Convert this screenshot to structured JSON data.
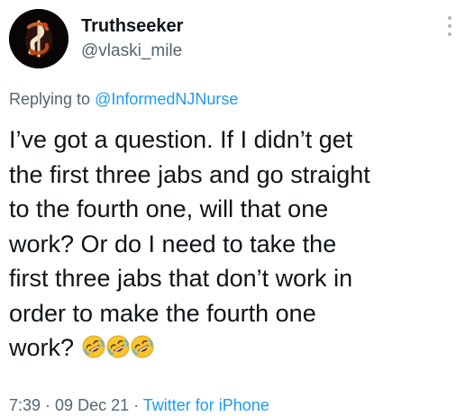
{
  "author": {
    "display_name": "Truthseeker",
    "handle": "@vlaski_mile",
    "avatar_icon": "dollar-sign-avatar-icon"
  },
  "reply": {
    "prefix": "Replying to ",
    "mention": "@InformedNJNurse"
  },
  "tweet": {
    "lines": [
      "I’ve got a question. If I didn’t get",
      "the first three jabs and go straight",
      "to the fourth one, will that one",
      "work? Or do I need to take the",
      "first three jabs that don’t work in",
      "order to make the fourth one",
      "work?"
    ],
    "emoji": [
      "rolling-on-floor-laughing-icon",
      "rolling-on-floor-laughing-icon",
      "rolling-on-floor-laughing-icon"
    ]
  },
  "meta": {
    "time": "7:39",
    "separator": " · ",
    "date": "09 Dec 21",
    "source": "Twitter for iPhone"
  },
  "colors": {
    "text": "#0f1419",
    "secondary": "#536471",
    "link": "#1d9bf0"
  }
}
